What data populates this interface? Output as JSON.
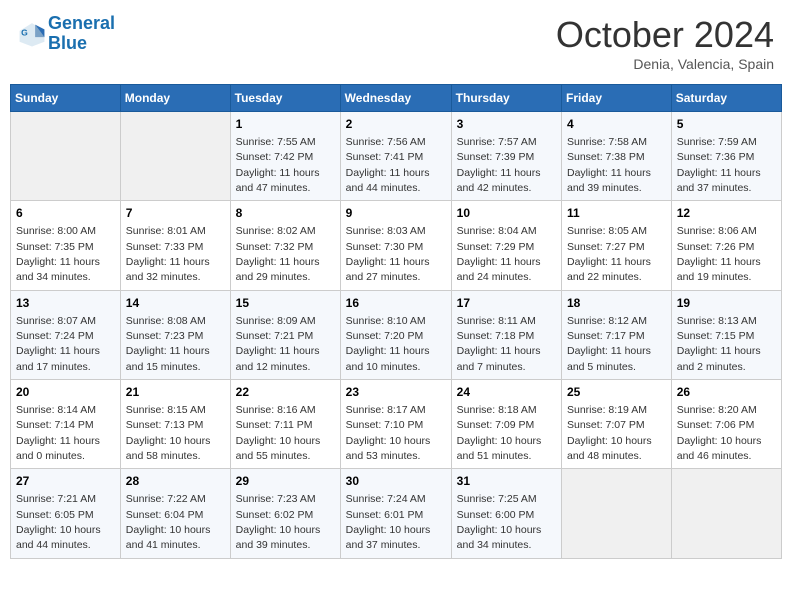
{
  "header": {
    "logo_line1": "General",
    "logo_line2": "Blue",
    "month": "October 2024",
    "location": "Denia, Valencia, Spain"
  },
  "days_of_week": [
    "Sunday",
    "Monday",
    "Tuesday",
    "Wednesday",
    "Thursday",
    "Friday",
    "Saturday"
  ],
  "weeks": [
    [
      {
        "day": "",
        "content": ""
      },
      {
        "day": "",
        "content": ""
      },
      {
        "day": "1",
        "content": "Sunrise: 7:55 AM\nSunset: 7:42 PM\nDaylight: 11 hours and 47 minutes."
      },
      {
        "day": "2",
        "content": "Sunrise: 7:56 AM\nSunset: 7:41 PM\nDaylight: 11 hours and 44 minutes."
      },
      {
        "day": "3",
        "content": "Sunrise: 7:57 AM\nSunset: 7:39 PM\nDaylight: 11 hours and 42 minutes."
      },
      {
        "day": "4",
        "content": "Sunrise: 7:58 AM\nSunset: 7:38 PM\nDaylight: 11 hours and 39 minutes."
      },
      {
        "day": "5",
        "content": "Sunrise: 7:59 AM\nSunset: 7:36 PM\nDaylight: 11 hours and 37 minutes."
      }
    ],
    [
      {
        "day": "6",
        "content": "Sunrise: 8:00 AM\nSunset: 7:35 PM\nDaylight: 11 hours and 34 minutes."
      },
      {
        "day": "7",
        "content": "Sunrise: 8:01 AM\nSunset: 7:33 PM\nDaylight: 11 hours and 32 minutes."
      },
      {
        "day": "8",
        "content": "Sunrise: 8:02 AM\nSunset: 7:32 PM\nDaylight: 11 hours and 29 minutes."
      },
      {
        "day": "9",
        "content": "Sunrise: 8:03 AM\nSunset: 7:30 PM\nDaylight: 11 hours and 27 minutes."
      },
      {
        "day": "10",
        "content": "Sunrise: 8:04 AM\nSunset: 7:29 PM\nDaylight: 11 hours and 24 minutes."
      },
      {
        "day": "11",
        "content": "Sunrise: 8:05 AM\nSunset: 7:27 PM\nDaylight: 11 hours and 22 minutes."
      },
      {
        "day": "12",
        "content": "Sunrise: 8:06 AM\nSunset: 7:26 PM\nDaylight: 11 hours and 19 minutes."
      }
    ],
    [
      {
        "day": "13",
        "content": "Sunrise: 8:07 AM\nSunset: 7:24 PM\nDaylight: 11 hours and 17 minutes."
      },
      {
        "day": "14",
        "content": "Sunrise: 8:08 AM\nSunset: 7:23 PM\nDaylight: 11 hours and 15 minutes."
      },
      {
        "day": "15",
        "content": "Sunrise: 8:09 AM\nSunset: 7:21 PM\nDaylight: 11 hours and 12 minutes."
      },
      {
        "day": "16",
        "content": "Sunrise: 8:10 AM\nSunset: 7:20 PM\nDaylight: 11 hours and 10 minutes."
      },
      {
        "day": "17",
        "content": "Sunrise: 8:11 AM\nSunset: 7:18 PM\nDaylight: 11 hours and 7 minutes."
      },
      {
        "day": "18",
        "content": "Sunrise: 8:12 AM\nSunset: 7:17 PM\nDaylight: 11 hours and 5 minutes."
      },
      {
        "day": "19",
        "content": "Sunrise: 8:13 AM\nSunset: 7:15 PM\nDaylight: 11 hours and 2 minutes."
      }
    ],
    [
      {
        "day": "20",
        "content": "Sunrise: 8:14 AM\nSunset: 7:14 PM\nDaylight: 11 hours and 0 minutes."
      },
      {
        "day": "21",
        "content": "Sunrise: 8:15 AM\nSunset: 7:13 PM\nDaylight: 10 hours and 58 minutes."
      },
      {
        "day": "22",
        "content": "Sunrise: 8:16 AM\nSunset: 7:11 PM\nDaylight: 10 hours and 55 minutes."
      },
      {
        "day": "23",
        "content": "Sunrise: 8:17 AM\nSunset: 7:10 PM\nDaylight: 10 hours and 53 minutes."
      },
      {
        "day": "24",
        "content": "Sunrise: 8:18 AM\nSunset: 7:09 PM\nDaylight: 10 hours and 51 minutes."
      },
      {
        "day": "25",
        "content": "Sunrise: 8:19 AM\nSunset: 7:07 PM\nDaylight: 10 hours and 48 minutes."
      },
      {
        "day": "26",
        "content": "Sunrise: 8:20 AM\nSunset: 7:06 PM\nDaylight: 10 hours and 46 minutes."
      }
    ],
    [
      {
        "day": "27",
        "content": "Sunrise: 7:21 AM\nSunset: 6:05 PM\nDaylight: 10 hours and 44 minutes."
      },
      {
        "day": "28",
        "content": "Sunrise: 7:22 AM\nSunset: 6:04 PM\nDaylight: 10 hours and 41 minutes."
      },
      {
        "day": "29",
        "content": "Sunrise: 7:23 AM\nSunset: 6:02 PM\nDaylight: 10 hours and 39 minutes."
      },
      {
        "day": "30",
        "content": "Sunrise: 7:24 AM\nSunset: 6:01 PM\nDaylight: 10 hours and 37 minutes."
      },
      {
        "day": "31",
        "content": "Sunrise: 7:25 AM\nSunset: 6:00 PM\nDaylight: 10 hours and 34 minutes."
      },
      {
        "day": "",
        "content": ""
      },
      {
        "day": "",
        "content": ""
      }
    ]
  ]
}
